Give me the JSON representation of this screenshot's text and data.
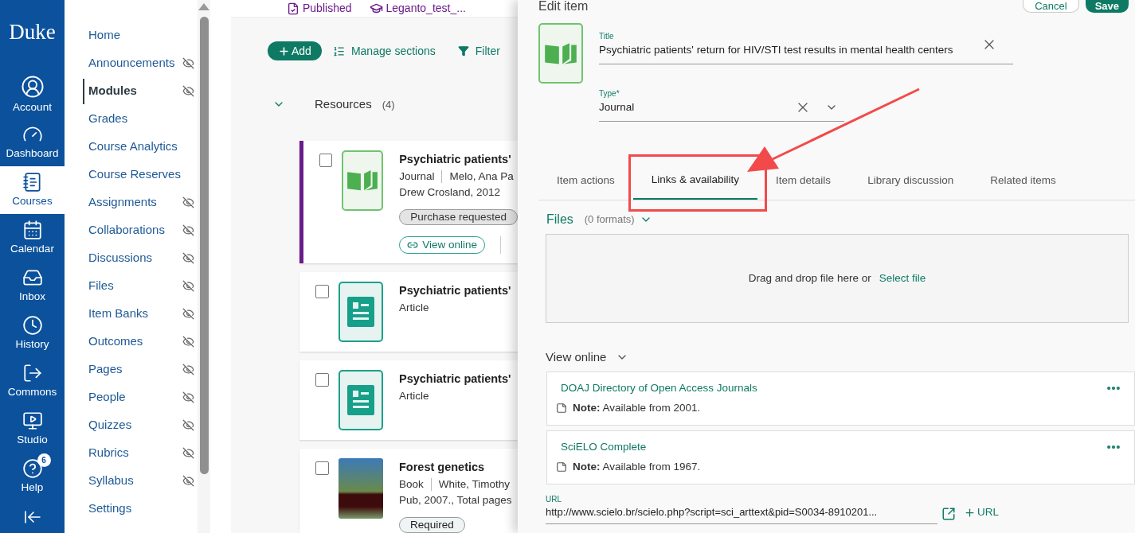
{
  "global_nav": {
    "logo": "Duke",
    "items": [
      {
        "label": "Account",
        "selected": false
      },
      {
        "label": "Dashboard",
        "selected": false
      },
      {
        "label": "Courses",
        "selected": true
      },
      {
        "label": "Calendar",
        "selected": false
      },
      {
        "label": "Inbox",
        "selected": false
      },
      {
        "label": "History",
        "selected": false
      },
      {
        "label": "Commons",
        "selected": false
      },
      {
        "label": "Studio",
        "selected": false
      },
      {
        "label": "Help",
        "selected": false,
        "badge": "6"
      }
    ]
  },
  "course_nav": {
    "items": [
      {
        "label": "Home",
        "selected": false,
        "hidden": false
      },
      {
        "label": "Announcements",
        "selected": false,
        "hidden": true
      },
      {
        "label": "Modules",
        "selected": true,
        "hidden": true
      },
      {
        "label": "Grades",
        "selected": false,
        "hidden": false
      },
      {
        "label": "Course Analytics",
        "selected": false,
        "hidden": false
      },
      {
        "label": "Course Reserves",
        "selected": false,
        "hidden": false
      },
      {
        "label": "Assignments",
        "selected": false,
        "hidden": true
      },
      {
        "label": "Collaborations",
        "selected": false,
        "hidden": true
      },
      {
        "label": "Discussions",
        "selected": false,
        "hidden": true
      },
      {
        "label": "Files",
        "selected": false,
        "hidden": true
      },
      {
        "label": "Item Banks",
        "selected": false,
        "hidden": true
      },
      {
        "label": "Outcomes",
        "selected": false,
        "hidden": true
      },
      {
        "label": "Pages",
        "selected": false,
        "hidden": true
      },
      {
        "label": "People",
        "selected": false,
        "hidden": true
      },
      {
        "label": "Quizzes",
        "selected": false,
        "hidden": true
      },
      {
        "label": "Rubrics",
        "selected": false,
        "hidden": true
      },
      {
        "label": "Syllabus",
        "selected": false,
        "hidden": true
      },
      {
        "label": "Settings",
        "selected": false,
        "hidden": false
      }
    ]
  },
  "top_bar": {
    "status": "Published",
    "course": "Leganto_test_..."
  },
  "toolbar": {
    "add": "Add",
    "manage": "Manage sections",
    "filter": "Filter"
  },
  "section": {
    "title": "Resources",
    "count": "(4)",
    "expanded": true
  },
  "resources": [
    {
      "kind": "journal",
      "title": "Psychiatric patients'",
      "type": "Journal",
      "author": "Melo, Ana Pa",
      "line2": "Drew Crosland, 2012",
      "tag": {
        "label": "Purchase requested",
        "kind": "status"
      },
      "link": "View online",
      "selected": true,
      "checked": false
    },
    {
      "kind": "article",
      "title": "Psychiatric patients'",
      "type": "Article",
      "selected": false,
      "checked": false
    },
    {
      "kind": "article",
      "title": "Psychiatric patients'",
      "type": "Article",
      "selected": false,
      "checked": false
    },
    {
      "kind": "book",
      "title": "Forest genetics",
      "type": "Book",
      "author": "White, Timothy",
      "line2": "Pub, 2007., Total pages",
      "tag": {
        "label": "Required",
        "kind": "required"
      },
      "selected": false,
      "checked": false
    }
  ],
  "panel": {
    "heading": "Edit item",
    "cancel": "Cancel",
    "save": "Save",
    "title_field": {
      "label": "Title",
      "value": "Psychiatric patients' return for HIV/STI test results in mental health centers"
    },
    "type_field": {
      "label": "Type*",
      "value": "Journal"
    },
    "tabs": [
      {
        "label": "Item actions",
        "selected": false
      },
      {
        "label": "Links & availability",
        "selected": true
      },
      {
        "label": "Item details",
        "selected": false
      },
      {
        "label": "Library discussion",
        "selected": false
      },
      {
        "label": "Related items",
        "selected": false
      }
    ],
    "files": {
      "heading": "Files",
      "count": "(0 formats)",
      "expanded": true,
      "drop_text": "Drag and drop file here or",
      "select_link": "Select file"
    },
    "view_online": {
      "heading": "View online",
      "expanded": true,
      "links": [
        {
          "name": "DOAJ Directory of Open Access Journals",
          "note": "**Note:** Available from 2001."
        },
        {
          "name": "SciELO Complete",
          "note": "**Note:** Available from 1967."
        }
      ]
    },
    "url_field": {
      "label": "URL",
      "value": "http://www.scielo.br/scielo.php?script=sci_arttext&pid=S0034-8910201...",
      "add_button": "URL"
    }
  }
}
